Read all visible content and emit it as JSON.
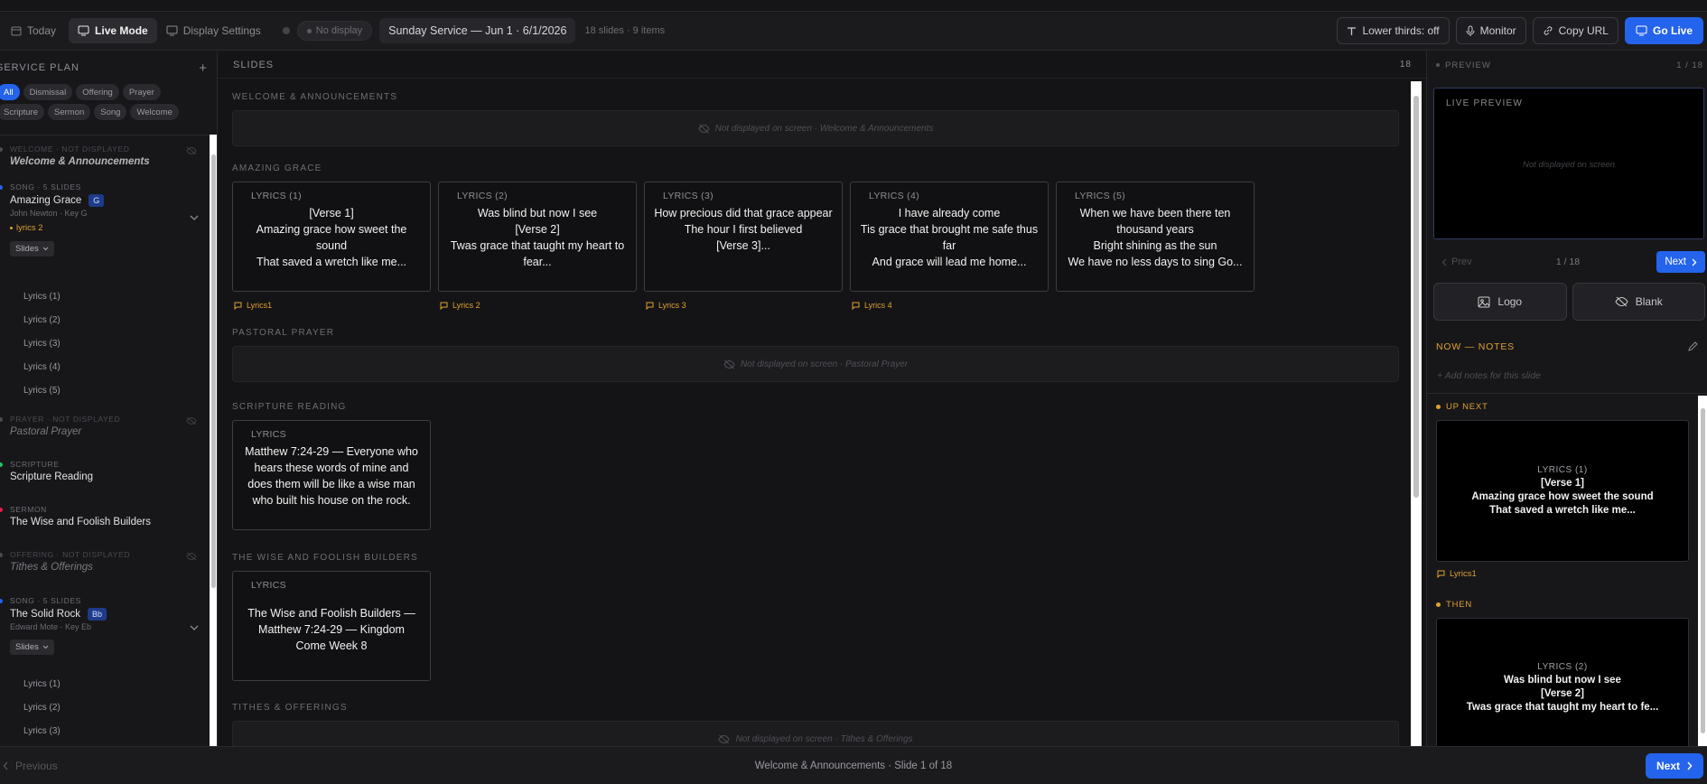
{
  "topbar": {
    "today": "Today",
    "live_mode": "Live Mode",
    "display_settings": "Display Settings",
    "no_display": "No display",
    "service": "Sunday Service — Jun 1 · 6/1/2026",
    "meta": "18 slides · 9 items",
    "lower_thirds": "Lower thirds: off",
    "monitor": "Monitor",
    "copy_url": "Copy URL",
    "go_live": "Go Live"
  },
  "sidebar": {
    "title": "SERVICE PLAN",
    "add": "+",
    "filters": [
      "All",
      "Dismissal",
      "Offering",
      "Prayer",
      "Scripture",
      "Sermon",
      "Song",
      "Welcome"
    ],
    "items": [
      {
        "cat": "WELCOME · NOT DISPLAYED",
        "title": "Welcome & Announcements",
        "dot": "#555555"
      },
      {
        "cat": "SONG · 5 SLIDES",
        "title": "Amazing Grace",
        "key": "G",
        "sub": "John Newton · Key G",
        "lyric_note": "lyrics 2",
        "dropdown": "Slides",
        "slides": [
          "Lyrics (1)",
          "Lyrics (2)",
          "Lyrics (3)",
          "Lyrics (4)",
          "Lyrics (5)"
        ],
        "dot": "#2463eb"
      },
      {
        "cat": "PRAYER · NOT DISPLAYED",
        "title": "Pastoral Prayer",
        "dot": "#555555"
      },
      {
        "cat": "SCRIPTURE",
        "title": "Scripture Reading",
        "dot": "#22c55e"
      },
      {
        "cat": "SERMON",
        "title": "The Wise and Foolish Builders",
        "dot": "#e11d48"
      },
      {
        "cat": "OFFERING · NOT DISPLAYED",
        "title": "Tithes & Offerings",
        "dot": "#555555"
      },
      {
        "cat": "SONG · 5 SLIDES",
        "title": "The Solid Rock",
        "key": "Bb",
        "sub": "Edward Mote · Key Eb",
        "dropdown": "Slides",
        "slides": [
          "Lyrics (1)",
          "Lyrics (2)",
          "Lyrics (3)"
        ],
        "dot": "#2463eb"
      }
    ]
  },
  "main": {
    "title": "SLIDES",
    "count": "18",
    "sections": [
      {
        "title": "WELCOME & ANNOUNCEMENTS",
        "not_displayed": "Not displayed on screen · Welcome & Announcements"
      },
      {
        "title": "AMAZING GRACE",
        "cards": [
          {
            "label": "LYRICS (1)",
            "text": "[Verse 1]\nAmazing grace how sweet the sound\nThat saved a wretch like me...",
            "note": "Lyrics1"
          },
          {
            "label": "LYRICS (2)",
            "text": "Was blind but now I see\n[Verse 2]\nTwas grace that taught my heart to fear...",
            "note": "Lyrics 2"
          },
          {
            "label": "LYRICS (3)",
            "text": "How precious did that grace appear\nThe hour I first believed\n[Verse 3]...",
            "note": "Lyrics 3"
          },
          {
            "label": "LYRICS (4)",
            "text": "I have already come\nTis grace that brought me safe thus far\nAnd grace will lead me home...",
            "note": "Lyrics 4"
          },
          {
            "label": "LYRICS (5)",
            "text": "When we have been there ten thousand years\nBright shining as the sun\nWe have no less days to sing Go...",
            "note": ""
          }
        ]
      },
      {
        "title": "PASTORAL PRAYER",
        "not_displayed": "Not displayed on screen · Pastoral Prayer"
      },
      {
        "title": "SCRIPTURE READING",
        "cards": [
          {
            "label": "LYRICS",
            "text": "Matthew 7:24-29 — Everyone who hears these words of mine and does them will be like a wise man who built his house on the rock.",
            "note": ""
          }
        ]
      },
      {
        "title": "THE WISE AND FOOLISH BUILDERS",
        "cards": [
          {
            "label": "LYRICS",
            "text": "The Wise and Foolish Builders — Matthew 7:24-29 — Kingdom Come Week 8",
            "note": ""
          }
        ]
      },
      {
        "title": "TITHES & OFFERINGS",
        "not_displayed": "Not displayed on screen · Tithes & Offerings"
      }
    ]
  },
  "preview": {
    "title": "PREVIEW",
    "count": "1 / 18",
    "live_label": "LIVE PREVIEW",
    "not_displayed": "Not displayed on screen",
    "prev": "Prev",
    "page": "1 / 18",
    "next": "Next",
    "logo": "Logo",
    "blank": "Blank",
    "notes_title": "NOW — NOTES",
    "notes_placeholder": "+ Add notes for this slide",
    "up_next_title": "UP NEXT",
    "up_next": {
      "label": "LYRICS (1)",
      "text": "[Verse 1]\nAmazing grace how sweet the sound\nThat saved a wretch like me...",
      "note": "Lyrics1"
    },
    "then_title": "THEN",
    "then": {
      "label": "LYRICS (2)",
      "text": "Was blind but now I see\n[Verse 2]\nTwas grace that taught my heart to fe..."
    }
  },
  "bottom": {
    "previous": "Previous",
    "status": "Welcome & Announcements · Slide 1 of 18",
    "next": "Next"
  }
}
